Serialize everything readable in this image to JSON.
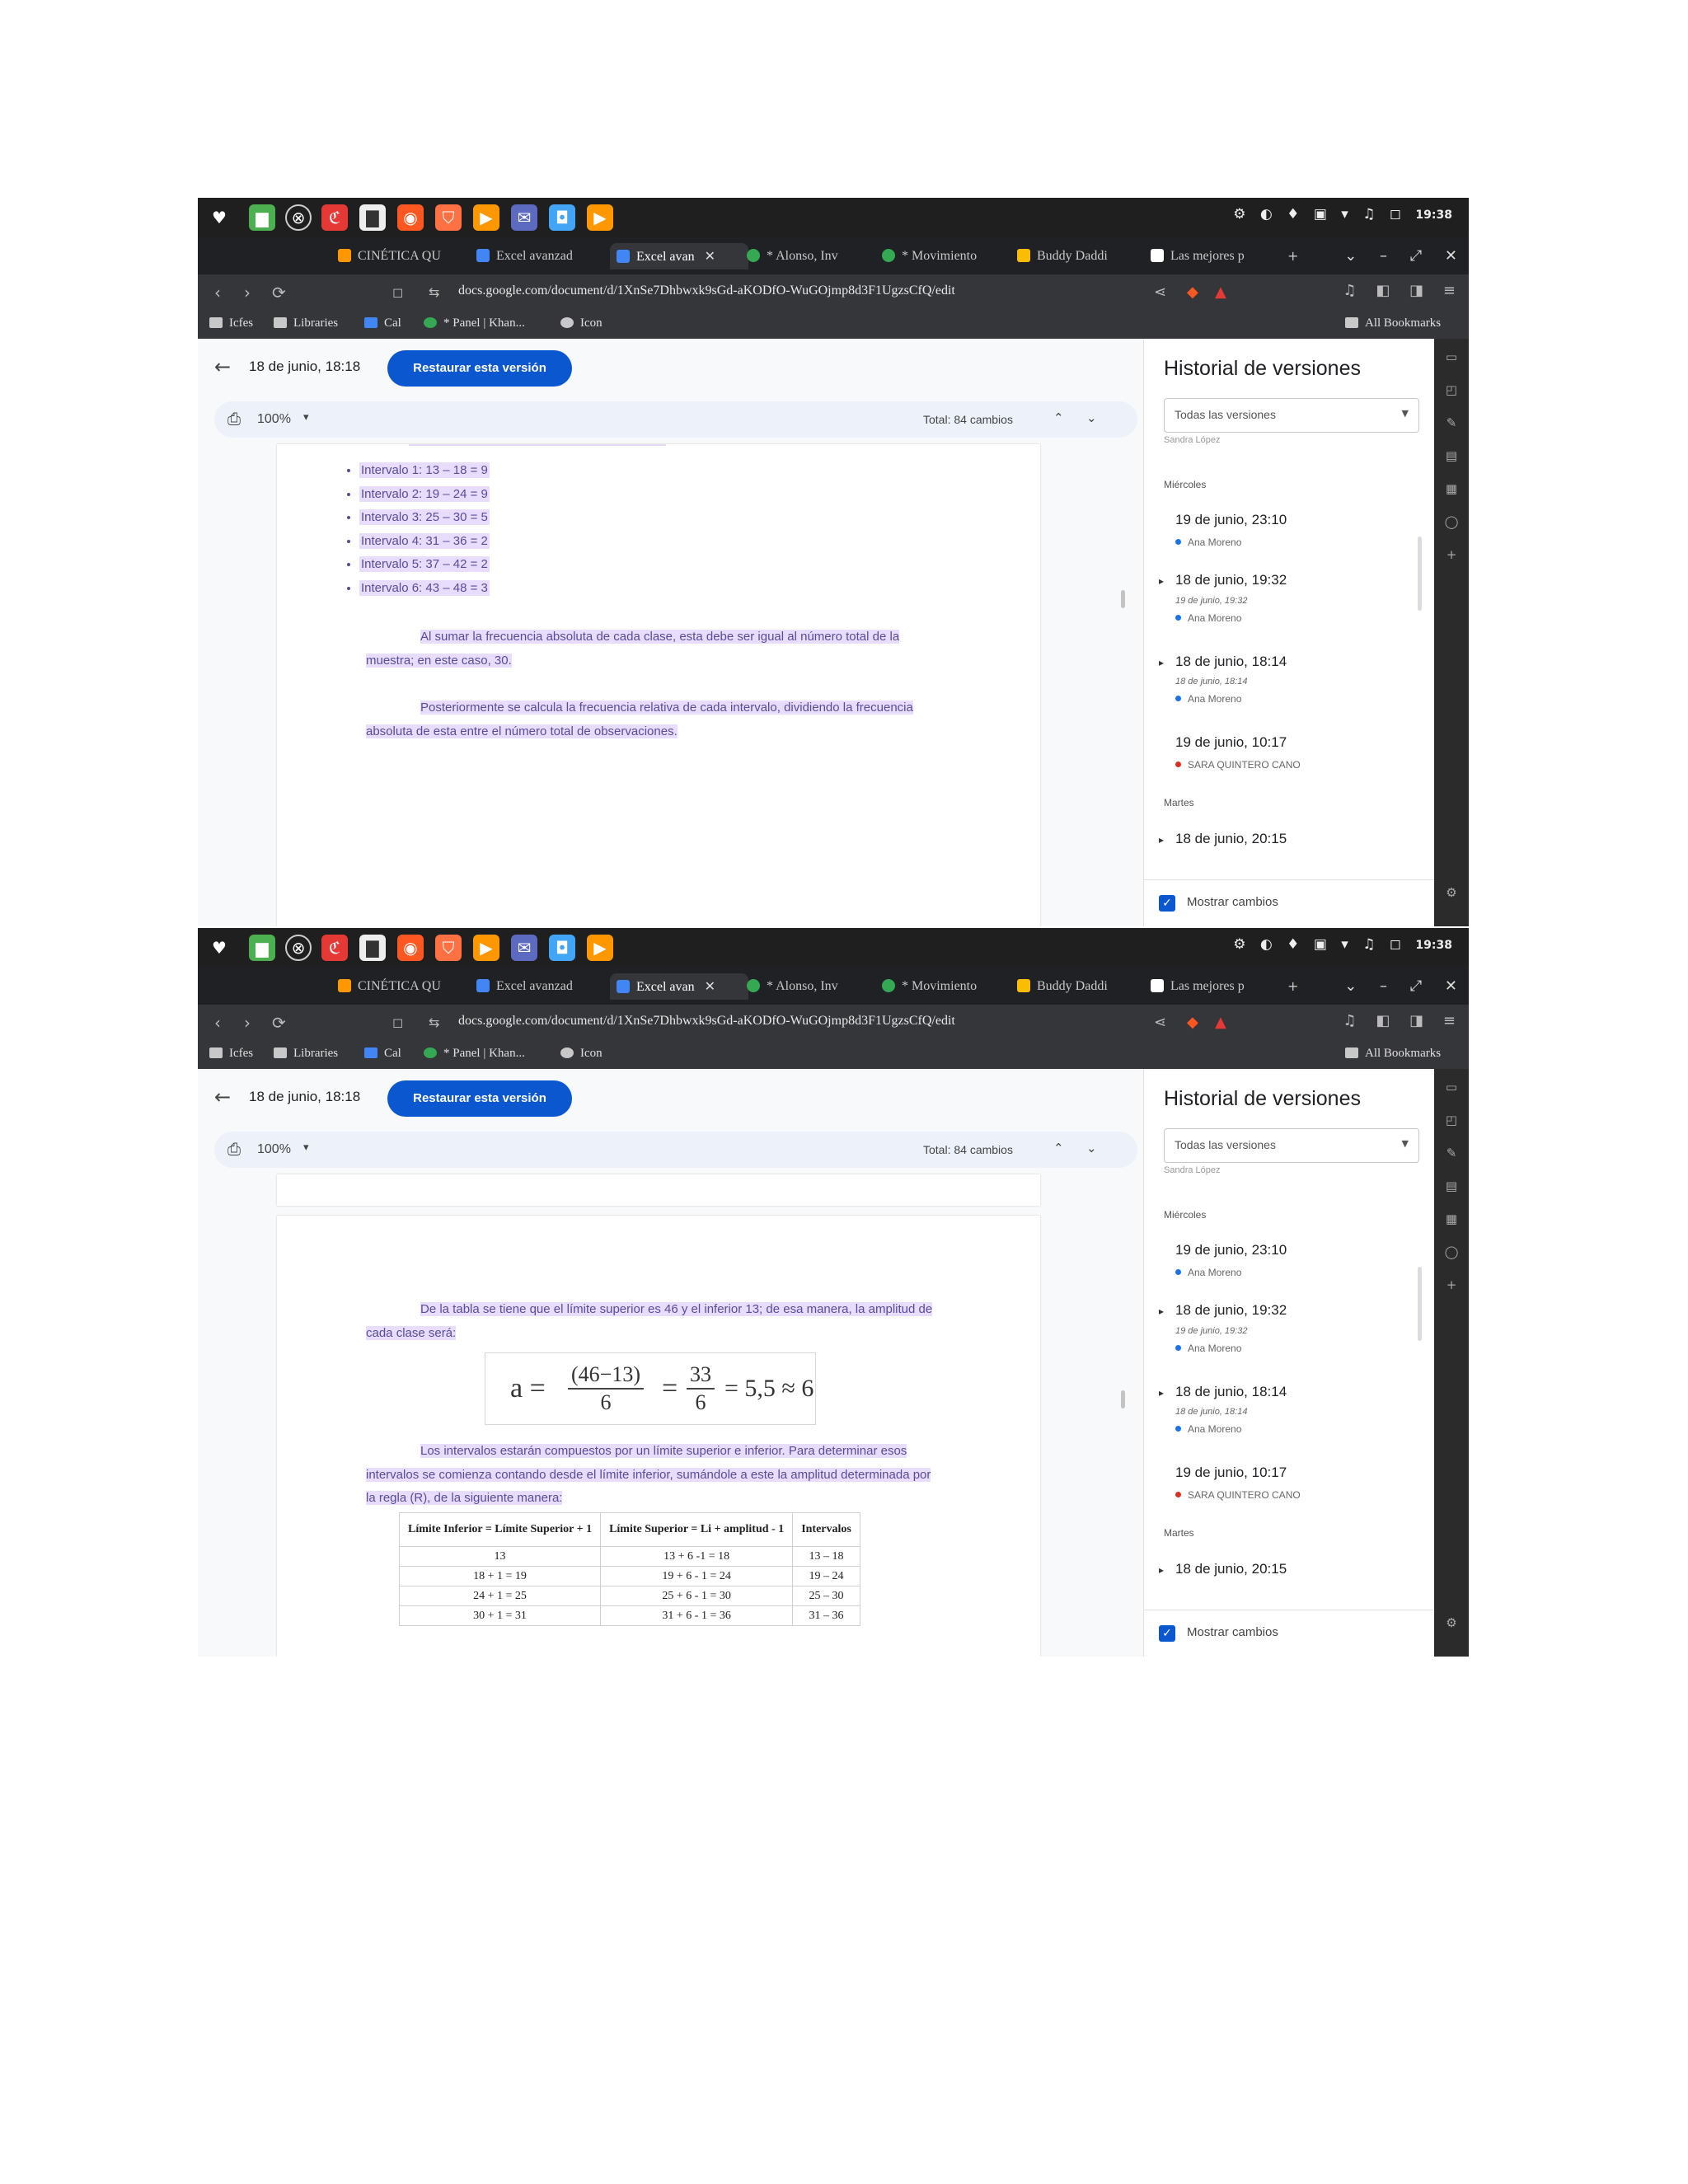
{
  "system_bar": {
    "icons": [
      "♥",
      "▆",
      "⊗",
      "ℭ",
      "▇",
      "◉",
      "⛉",
      "▶",
      "✉",
      "◘",
      "▶"
    ],
    "icon_colors": [
      "#1f1f1f",
      "#4caf50",
      "#444444",
      "#e53935",
      "#eeeeee",
      "#ff5722",
      "#ff7043",
      "#ff9800",
      "#5c6bc0",
      "#42a5f5",
      "#ff9800"
    ],
    "tray": [
      "⚙",
      "◐",
      "♦",
      "▣",
      "▾",
      "♫",
      "◻"
    ],
    "clock": "19:38"
  },
  "tabs": [
    {
      "label": "CINÉTICA QU",
      "color": "#ff9800"
    },
    {
      "label": "Excel avanzad",
      "color": "#4285f4"
    },
    {
      "label": "Excel avan",
      "color": "#4285f4"
    },
    {
      "label": "* Alonso, Inv",
      "color": "#34a853"
    },
    {
      "label": "* Movimiento",
      "color": "#34a853"
    },
    {
      "label": "Buddy Daddi",
      "color": "#fbbc04"
    },
    {
      "label": "Las mejores p",
      "color": "#ffffff"
    }
  ],
  "new_tab": "+",
  "window_controls": [
    "⌄",
    "–",
    "⤢",
    "✕"
  ],
  "address_bar": {
    "url": "docs.google.com/document/d/1XnSe7Dhbwxk9sGd-aKODfO-WuGOjmp8d3F1UgzsCfQ/edit"
  },
  "bookmarks": [
    {
      "label": "Icfes"
    },
    {
      "label": "Libraries"
    },
    {
      "label": "Cal"
    },
    {
      "label": "* Panel | Khan..."
    },
    {
      "label": "Icon"
    }
  ],
  "bookmarks_right": "All Bookmarks",
  "docs": {
    "version_time": "18 de junio, 18:18",
    "restore_label": "Restaurar esta versión",
    "zoom": "100%",
    "total_changes": "Total: 84 cambios"
  },
  "page1": {
    "intervals": [
      "Intervalo 1: 13 – 18 = 9",
      "Intervalo 2: 19 – 24 = 9",
      "Intervalo 3: 25 – 30 = 5",
      "Intervalo 4: 31 – 36 = 2",
      "Intervalo 5: 37 – 42 = 2",
      "Intervalo 6: 43 – 48 = 3"
    ],
    "para1": "Al sumar la frecuencia absoluta de cada clase, esta debe ser igual al número total de la muestra; en este caso, 30.",
    "para2": "Posteriormente se calcula la frecuencia relativa de cada intervalo, dividiendo la frecuencia absoluta de esta entre el número total de observaciones."
  },
  "page2": {
    "para1": "De la tabla se tiene que el límite superior es 46 y el inferior 13; de esa manera, la amplitud de cada clase será:",
    "formula": {
      "lhs": "a =",
      "frac1_num": "(46−13)",
      "frac1_den": "6",
      "eq": "=",
      "frac2_num": "33",
      "frac2_den": "6",
      "rhs": "= 5,5 ≈ 6"
    },
    "para2": "Los intervalos estarán compuestos por un límite superior e inferior. Para determinar esos intervalos se comienza contando desde el límite inferior, sumándole a este la amplitud determinada por la regla (R), de la siguiente manera:",
    "table": {
      "headers": [
        "Límite Inferior = Límite Superior + 1",
        "Límite Superior = Li + amplitud - 1",
        "Intervalos"
      ],
      "rows": [
        [
          "13",
          "13 + 6 -1 = 18",
          "13 – 18"
        ],
        [
          "18 + 1 = 19",
          "19 + 6 - 1 = 24",
          "19 – 24"
        ],
        [
          "24 + 1 = 25",
          "25 + 6 - 1 = 30",
          "25 – 30"
        ],
        [
          "30 + 1 = 31",
          "31 + 6 - 1 = 36",
          "31 – 36"
        ]
      ]
    }
  },
  "panel": {
    "title": "Historial de versiones",
    "filter": "Todas las versiones",
    "clipped_author": "Sandra López",
    "days": [
      "Miércoles",
      "Martes"
    ],
    "entries": [
      {
        "date": "19 de junio, 23:10",
        "sub": "",
        "author": "Ana Moreno",
        "author_color": "#1a73e8",
        "arrow": ""
      },
      {
        "date": "18 de junio, 19:32",
        "sub": "19 de junio, 19:32",
        "author": "Ana Moreno",
        "author_color": "#1a73e8",
        "arrow": "▸"
      },
      {
        "date": "18 de junio, 18:14",
        "sub": "18 de junio, 18:14",
        "author": "Ana Moreno",
        "author_color": "#1a73e8",
        "arrow": "▸"
      },
      {
        "date": "19 de junio, 10:17",
        "sub": "",
        "author": "SARA QUINTERO CANO",
        "author_color": "#d93025",
        "arrow": ""
      },
      {
        "date": "18 de junio, 20:15",
        "sub": "",
        "author": "",
        "author_color": "",
        "arrow": "▸"
      }
    ],
    "show_changes": "Mostrar cambios"
  },
  "rail_icons": [
    "▭",
    "◰",
    "✎",
    "▤",
    "▦",
    "◯",
    "+",
    "⚙"
  ]
}
